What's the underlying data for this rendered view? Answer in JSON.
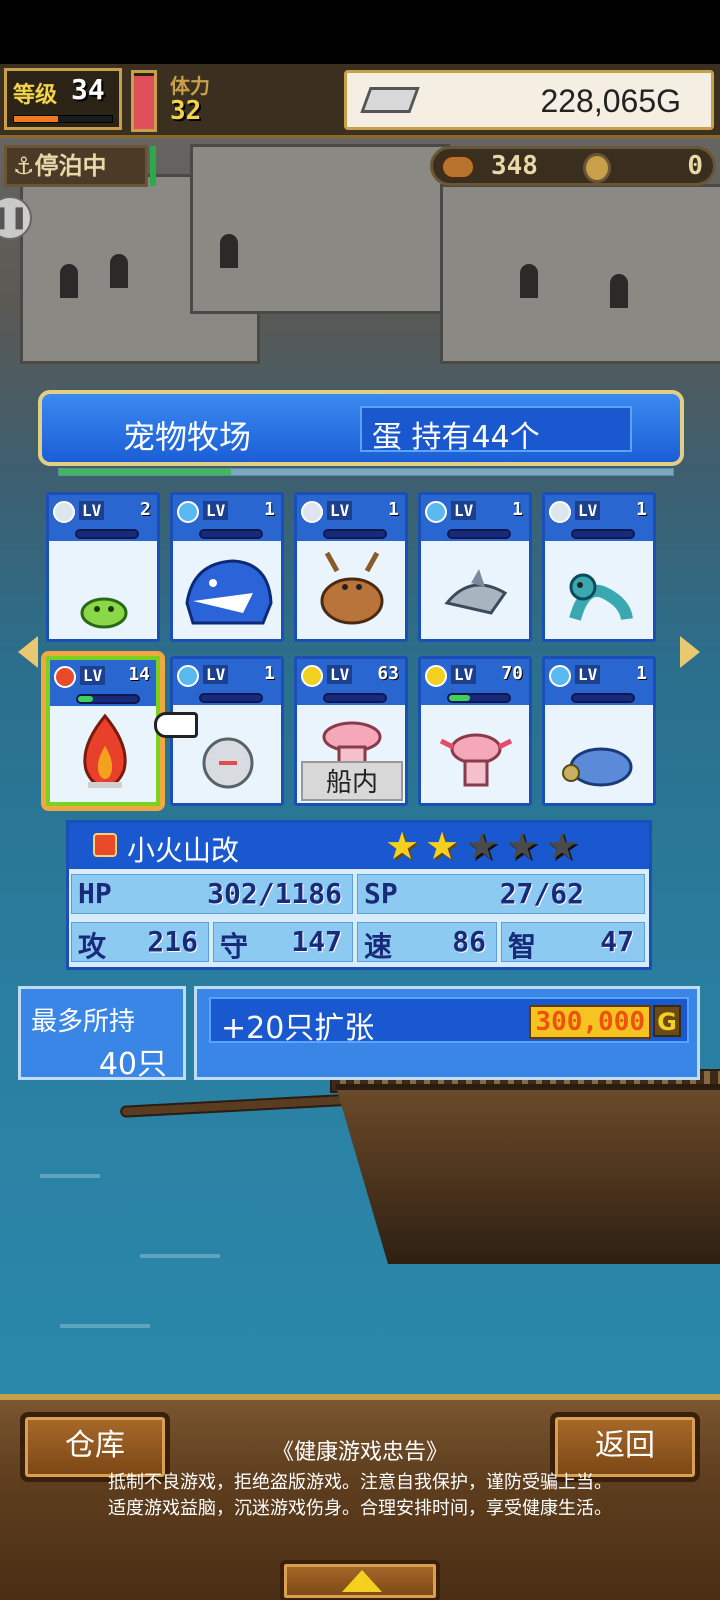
{
  "hud": {
    "level_label": "等级",
    "level": "34",
    "xp_fraction": 0.45,
    "stamina_label": "体力",
    "stamina": "32",
    "stamina_fraction": 0.95,
    "gold": "228,065G",
    "status": "停泊中",
    "food": "348",
    "medals": "0"
  },
  "panel": {
    "title": "宠物牧场",
    "eggs": "蛋 持有44个",
    "scroll_fraction": 0.28,
    "cards": [
      {
        "lv_label": "LV",
        "level": "2",
        "hp_fraction": 1.0,
        "element": "neutral",
        "sprite": "green-slime",
        "badge": ""
      },
      {
        "lv_label": "LV",
        "level": "1",
        "hp_fraction": 1.0,
        "element": "water",
        "sprite": "blue-sea-monster",
        "badge": ""
      },
      {
        "lv_label": "LV",
        "level": "1",
        "hp_fraction": 1.0,
        "element": "neutral",
        "sprite": "brown-moose",
        "badge": ""
      },
      {
        "lv_label": "LV",
        "level": "1",
        "hp_fraction": 1.0,
        "element": "water",
        "sprite": "grey-shark",
        "badge": ""
      },
      {
        "lv_label": "LV",
        "level": "1",
        "hp_fraction": 1.0,
        "element": "neutral",
        "sprite": "teal-snake",
        "badge": ""
      },
      {
        "lv_label": "LV",
        "level": "14",
        "hp_fraction": 0.25,
        "element": "fire",
        "sprite": "red-flame",
        "badge": ""
      },
      {
        "lv_label": "LV",
        "level": "1",
        "hp_fraction": 1.0,
        "element": "water",
        "sprite": "white-urchin",
        "badge": ""
      },
      {
        "lv_label": "LV",
        "level": "63",
        "hp_fraction": 1.0,
        "element": "electric",
        "sprite": "pink-axolotl",
        "badge": "船内"
      },
      {
        "lv_label": "LV",
        "level": "70",
        "hp_fraction": 0.35,
        "element": "electric",
        "sprite": "pink-crab",
        "badge": ""
      },
      {
        "lv_label": "LV",
        "level": "1",
        "hp_fraction": 1.0,
        "element": "water",
        "sprite": "blue-turtle",
        "badge": ""
      }
    ],
    "selected": {
      "name": "小火山改",
      "stars": 2,
      "max_stars": 5,
      "hp_label": "HP",
      "hp": "302/1186",
      "sp_label": "SP",
      "sp": "27/62",
      "atk_label": "攻",
      "atk": "216",
      "def_label": "守",
      "def": "147",
      "spd_label": "速",
      "spd": "86",
      "int_label": "智",
      "int": "47"
    },
    "capacity_label": "最多所持",
    "capacity": "40只",
    "expand_label": "+20只扩张",
    "expand_cost": "300,000",
    "expand_unit": "G"
  },
  "bottom": {
    "warehouse": "仓库",
    "back": "返回",
    "notice_title": "《健康游戏忠告》",
    "notice_line1": "抵制不良游戏，拒绝盗版游戏。注意自我保护，谨防受骗上当。",
    "notice_line2": "适度游戏益脑，沉迷游戏伤身。合理安排时间，享受健康生活。"
  },
  "colors": {
    "fire": "#e84a2a",
    "water": "#58b8f0",
    "electric": "#f0d020",
    "neutral": "#dde6ee"
  }
}
